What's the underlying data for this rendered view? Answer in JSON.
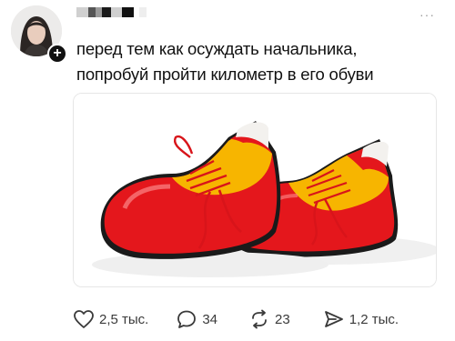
{
  "post": {
    "username_masked": "",
    "more_label": "···",
    "text_line1": "перед тем как осуждать начальника,",
    "text_line2": "попробуй пройти километр в его обуви",
    "follow_label": "+",
    "image": {
      "icon": "clown-shoes-image",
      "colors": {
        "shoe_red": "#e4171c",
        "shoe_yellow": "#f7b500",
        "sole_black": "#1a1a1a"
      }
    }
  },
  "actions": {
    "likes": "2,5 тыс.",
    "comments": "34",
    "reposts": "23",
    "shares": "1,2 тыс."
  }
}
